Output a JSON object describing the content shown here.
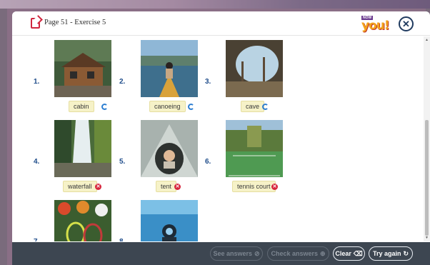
{
  "window": {
    "title": "Page 51 - Exercise 5"
  },
  "brand": {
    "small": "NOW",
    "logo": "you!"
  },
  "items": [
    {
      "number": "1.",
      "label": "cabin",
      "status": "correct"
    },
    {
      "number": "2.",
      "label": "canoeing",
      "status": "correct"
    },
    {
      "number": "3.",
      "label": "cave",
      "status": "correct"
    },
    {
      "number": "4.",
      "label": "waterfall",
      "status": "incorrect"
    },
    {
      "number": "5.",
      "label": "tent",
      "status": "incorrect"
    },
    {
      "number": "6.",
      "label": "tennis court",
      "status": "incorrect"
    },
    {
      "number": "7.",
      "label": "",
      "status": ""
    },
    {
      "number": "8.",
      "label": "",
      "status": ""
    }
  ],
  "footer": {
    "see_answers": "See answers",
    "check_answers": "Check answers",
    "clear": "Clear",
    "try_again": "Try again"
  },
  "colors": {
    "correct": "#2e7fd2",
    "incorrect": "#d7263d",
    "footer_bg": "#3d4651",
    "label_bg": "#f6f2c8"
  }
}
